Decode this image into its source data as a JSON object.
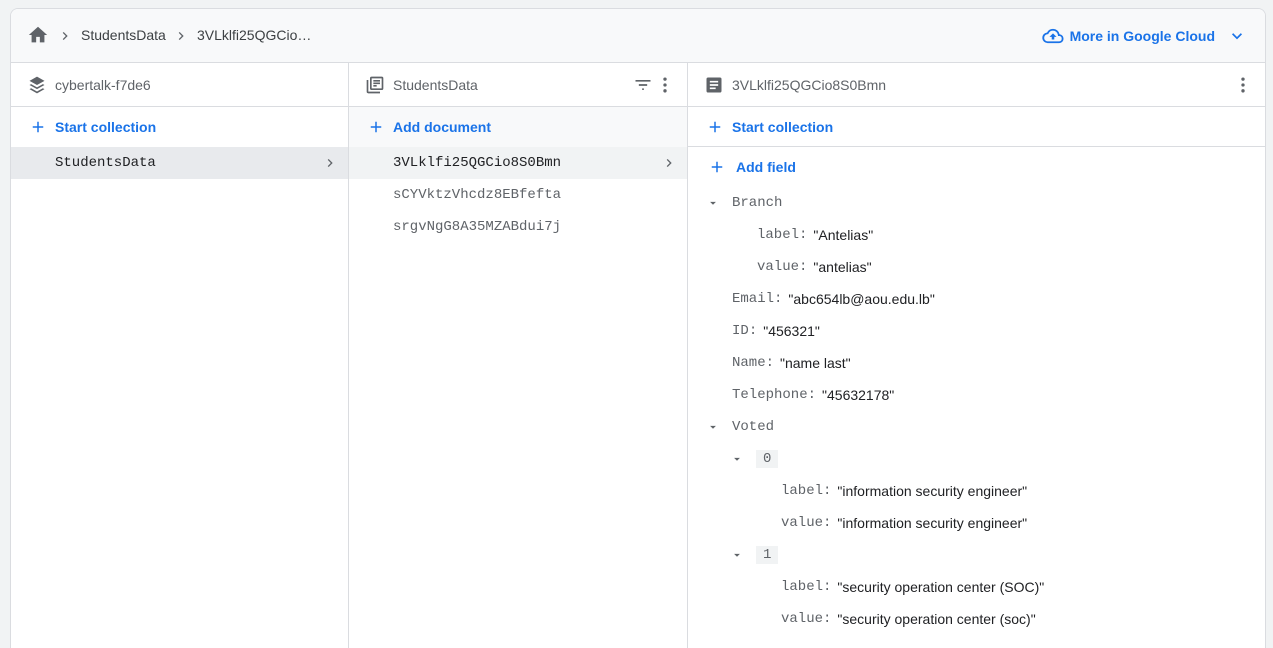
{
  "breadcrumb": {
    "items": [
      "StudentsData",
      "3VLklfi25QGCio…"
    ]
  },
  "header": {
    "more_cloud_label": "More in Google Cloud"
  },
  "root_panel": {
    "title": "cybertalk-f7de6",
    "action_label": "Start collection",
    "items": [
      "StudentsData"
    ]
  },
  "collection_panel": {
    "title": "StudentsData",
    "action_label": "Add document",
    "documents": [
      "3VLklfi25QGCio8S0Bmn",
      "sCYVktzVhcdz8EBfefta",
      "srgvNgG8A35MZABdui7j"
    ]
  },
  "document_panel": {
    "title": "3VLklfi25QGCio8S0Bmn",
    "start_collection_label": "Start collection",
    "add_field_label": "Add field",
    "branch": {
      "key": "Branch",
      "label_key": "label",
      "label_value": "\"Antelias\"",
      "value_key": "value",
      "value_value": "\"antelias\""
    },
    "email": {
      "key": "Email",
      "value": "\"abc654lb@aou.edu.lb\""
    },
    "id": {
      "key": "ID",
      "value": "\"456321\""
    },
    "name": {
      "key": "Name",
      "value": "\"name last\""
    },
    "telephone": {
      "key": "Telephone",
      "value": "\"45632178\""
    },
    "voted": {
      "key": "Voted",
      "items": [
        {
          "index": "0",
          "label_key": "label",
          "label_value": "\"information security engineer\"",
          "value_key": "value",
          "value_value": "\"information security engineer\""
        },
        {
          "index": "1",
          "label_key": "label",
          "label_value": "\"security operation center (SOC)\"",
          "value_key": "value",
          "value_value": "\"security operation center (soc)\""
        }
      ]
    }
  },
  "colors": {
    "accent": "#1a73e8",
    "selected_row": "#e8eaed",
    "border": "#dadce0"
  }
}
